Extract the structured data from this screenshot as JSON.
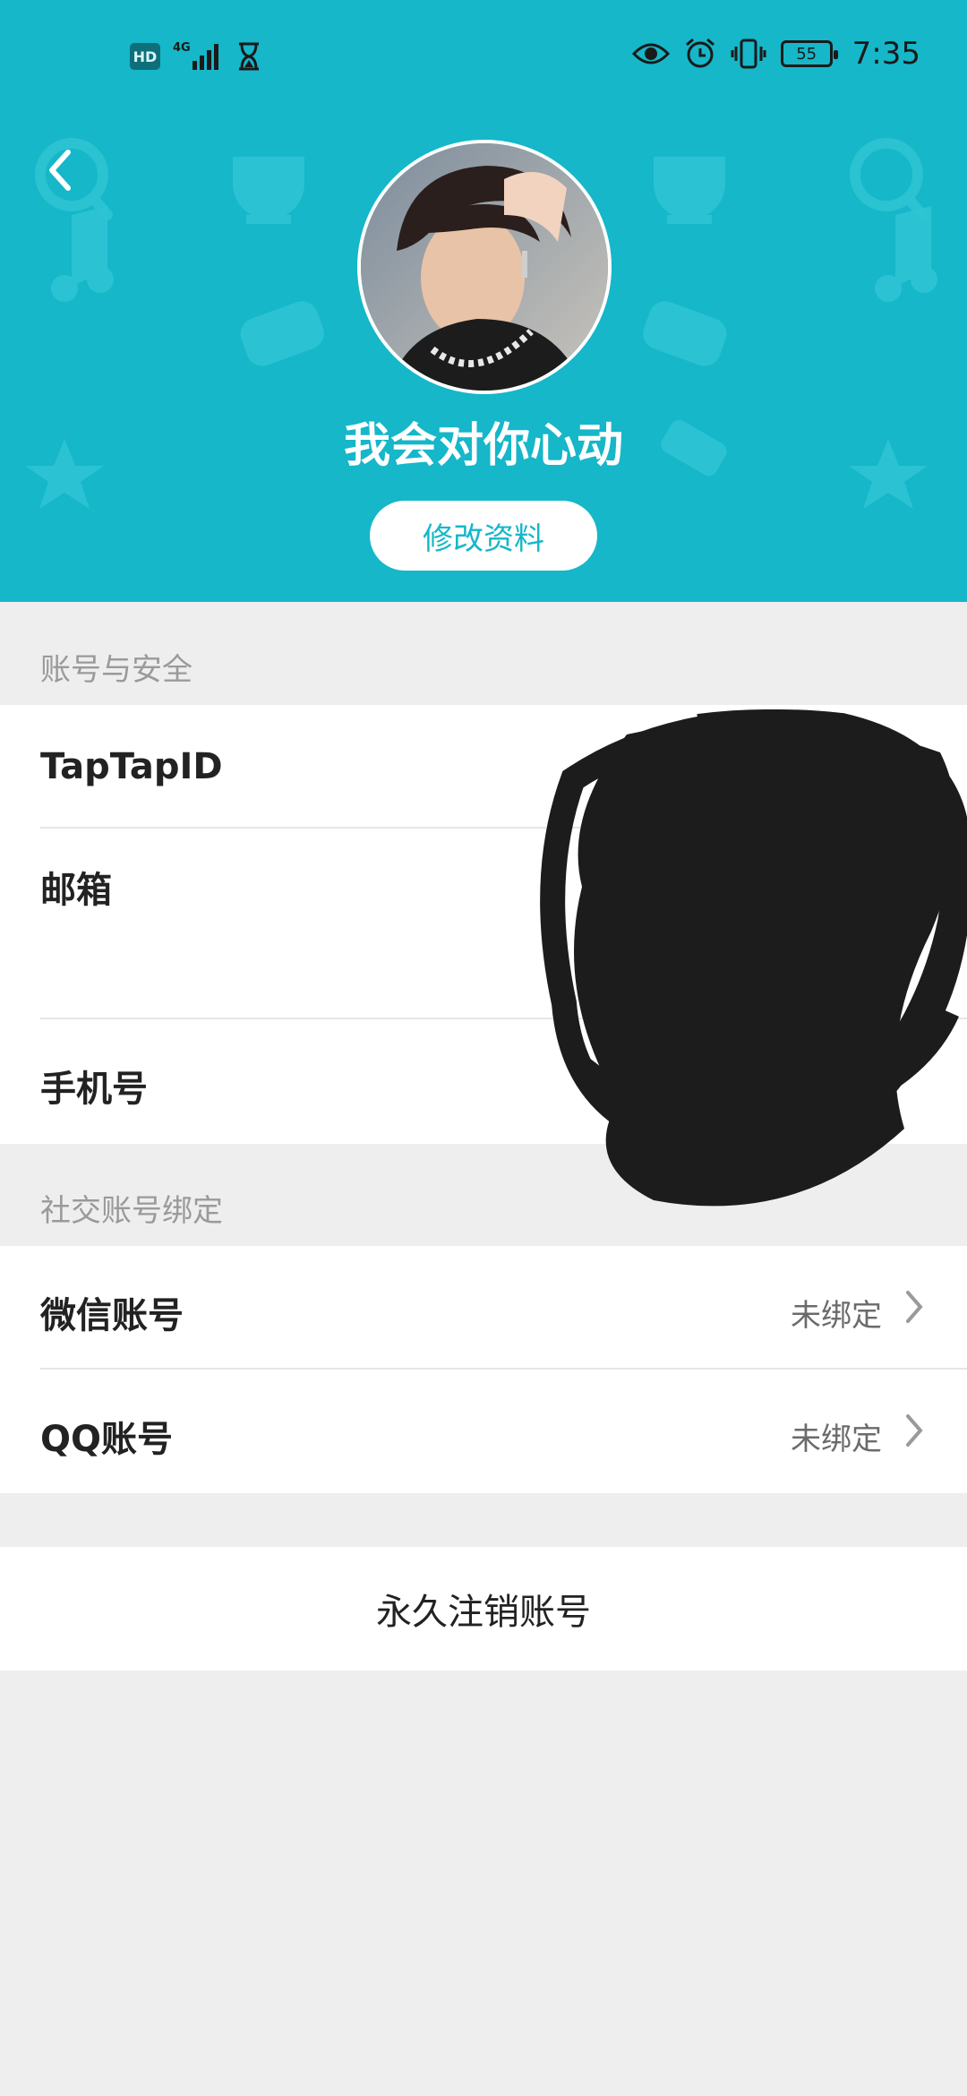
{
  "status_bar": {
    "hd": "HD",
    "network": "4G",
    "battery": "55",
    "time": "7:35",
    "icons": [
      "hd-icon",
      "signal-4g-icon",
      "hourglass-icon",
      "eye-icon",
      "alarm-icon",
      "vibrate-icon",
      "battery-icon"
    ]
  },
  "profile": {
    "username": "我会对你心动",
    "edit_button": "修改资料"
  },
  "account_security": {
    "title": "账号与安全",
    "rows": [
      {
        "label": "TapTapID"
      },
      {
        "label": "邮箱"
      },
      {
        "label": "手机号"
      }
    ]
  },
  "social_binding": {
    "title": "社交账号绑定",
    "rows": [
      {
        "label": "微信账号",
        "status": "未绑定"
      },
      {
        "label": "QQ账号",
        "status": "未绑定"
      }
    ]
  },
  "delete_account": {
    "label": "永久注销账号"
  },
  "colors": {
    "header": "#15b7c9",
    "background": "#eeeeee",
    "card": "#ffffff",
    "section_title": "#9a9a9a"
  }
}
